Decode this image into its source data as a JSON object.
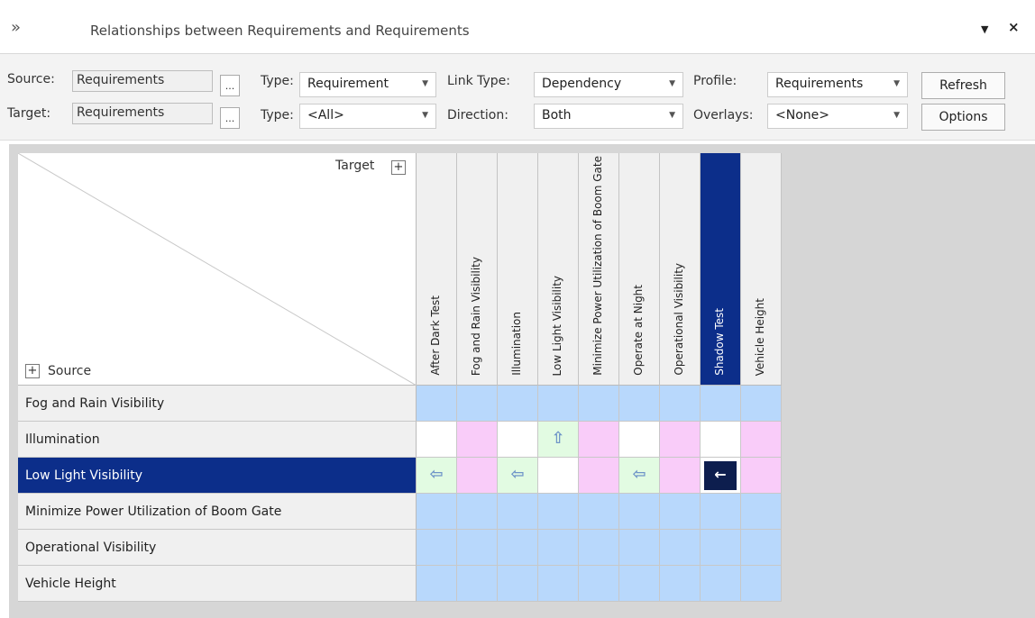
{
  "window": {
    "title": "Relationships between Requirements and Requirements",
    "chevron_icon": "»",
    "menu_icon": "▼",
    "close_icon": "×"
  },
  "toolbar": {
    "source_label": "Source:",
    "source_value": "Requirements",
    "target_label": "Target:",
    "target_value": "Requirements",
    "browse_label": "...",
    "type_label": "Type:",
    "source_type_value": "Requirement",
    "target_type_value": "<All>",
    "link_type_label": "Link Type:",
    "link_type_value": "Dependency",
    "direction_label": "Direction:",
    "direction_value": "Both",
    "profile_label": "Profile:",
    "profile_value": "Requirements",
    "overlays_label": "Overlays:",
    "overlays_value": "<None>",
    "refresh_label": "Refresh",
    "options_label": "Options",
    "dropdown_arrow": "▼"
  },
  "matrix": {
    "target_header": "Target",
    "source_header": "Source",
    "expand_symbol": "+",
    "columns": [
      "After Dark Test",
      "Fog and Rain Visibility",
      "Illumination",
      "Low Light Visibility",
      "Minimize Power Utilization of Boom Gate",
      "Operate at Night",
      "Operational Visibility",
      "Shadow Test",
      "Vehicle Height"
    ],
    "selected_column": "Shadow Test",
    "rows": [
      "Fog and Rain Visibility",
      "Illumination",
      "Low Light Visibility",
      "Minimize Power Utilization of Boom Gate",
      "Operational Visibility",
      "Vehicle Height"
    ],
    "selected_row": "Low Light Visibility",
    "arrows": {
      "left": "⇦",
      "up": "⇧",
      "selected_left": "←"
    },
    "colors": {
      "empty_row": "#b8d8fc",
      "no_link_white": "#ffffff",
      "no_link_pink": "#f9ccf9",
      "link_cell": "#e2fbe2",
      "selection": "#0c2e8a"
    }
  }
}
